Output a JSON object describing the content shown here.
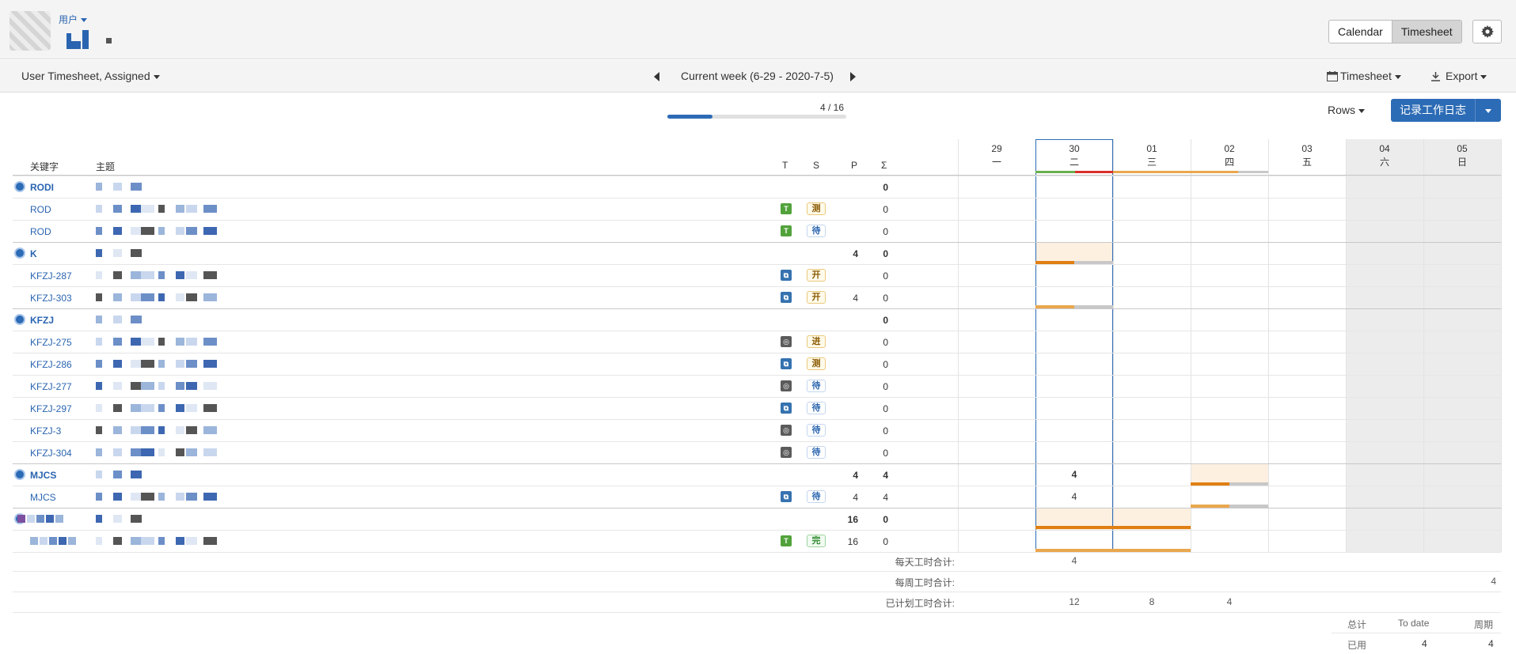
{
  "header": {
    "user_label": "用户",
    "view_buttons": [
      "Calendar",
      "Timesheet"
    ],
    "active_view": "Timesheet"
  },
  "toolbar": {
    "filter_label": "User Timesheet, Assigned",
    "week_label": "Current week (6-29 - 2020-7-5)",
    "timesheet_label": "Timesheet",
    "export_label": "Export"
  },
  "progress": {
    "text": "4 / 16",
    "fraction": 0.25
  },
  "actions": {
    "rows_label": "Rows",
    "log_work_label": "记录工作日志"
  },
  "columns": {
    "key": "关键字",
    "summary": "主题",
    "type": "T",
    "status": "S",
    "planned": "P",
    "sum": "Σ"
  },
  "days": [
    {
      "date": "29",
      "weekday": "一"
    },
    {
      "date": "30",
      "weekday": "二"
    },
    {
      "date": "01",
      "weekday": "三"
    },
    {
      "date": "02",
      "weekday": "四"
    },
    {
      "date": "03",
      "weekday": "五"
    },
    {
      "date": "04",
      "weekday": "六"
    },
    {
      "date": "05",
      "weekday": "日"
    }
  ],
  "rows": [
    {
      "key": "RODI",
      "group": true,
      "p": "",
      "sum": "0"
    },
    {
      "key": "ROD",
      "type": "T",
      "status": "测",
      "p": "",
      "sum": "0"
    },
    {
      "key": "ROD",
      "type": "T",
      "status": "待",
      "p": "",
      "sum": "0"
    },
    {
      "key": "K",
      "group": true,
      "p": "4",
      "sum": "0"
    },
    {
      "key": "KFZJ-287",
      "type": "S",
      "status": "开",
      "p": "",
      "sum": "0"
    },
    {
      "key": "KFZJ-303",
      "type": "S",
      "status": "开",
      "p": "4",
      "sum": "0"
    },
    {
      "key": "KFZJ",
      "group": true,
      "p": "",
      "sum": "0"
    },
    {
      "key": "KFZJ-275",
      "type": "O",
      "status": "进",
      "p": "",
      "sum": "0"
    },
    {
      "key": "KFZJ-286",
      "type": "S",
      "status": "测",
      "p": "",
      "sum": "0"
    },
    {
      "key": "KFZJ-277",
      "type": "O",
      "status": "待",
      "p": "",
      "sum": "0"
    },
    {
      "key": "KFZJ-297",
      "type": "S",
      "status": "待",
      "p": "",
      "sum": "0"
    },
    {
      "key": "KFZJ-3",
      "type": "O",
      "status": "待",
      "p": "",
      "sum": "0"
    },
    {
      "key": "KFZJ-304",
      "type": "O",
      "status": "待",
      "p": "",
      "sum": "0"
    },
    {
      "key": "MJCS",
      "group": true,
      "p": "4",
      "sum": "4",
      "day30": "4"
    },
    {
      "key": "MJCS",
      "type": "S",
      "status": "待",
      "p": "4",
      "sum": "4",
      "day30": "4"
    },
    {
      "key": "",
      "group": true,
      "p": "16",
      "sum": "0"
    },
    {
      "key": "",
      "type": "T",
      "status": "完",
      "p": "16",
      "sum": "0"
    }
  ],
  "summary": {
    "daily_label": "每天工时合计:",
    "daily_values": [
      "",
      "4",
      "",
      "",
      "",
      "",
      ""
    ],
    "weekly_label": "每周工时合计:",
    "weekly_value": "4",
    "planned_label": "已计划工时合计:",
    "planned_values": [
      "",
      "12",
      "8",
      "4",
      "",
      "",
      ""
    ]
  },
  "footer": {
    "col_total": "总计",
    "col_to_date": "To date",
    "col_period": "周期",
    "row_label": "已用",
    "to_date_value": "4",
    "period_value": "4"
  }
}
